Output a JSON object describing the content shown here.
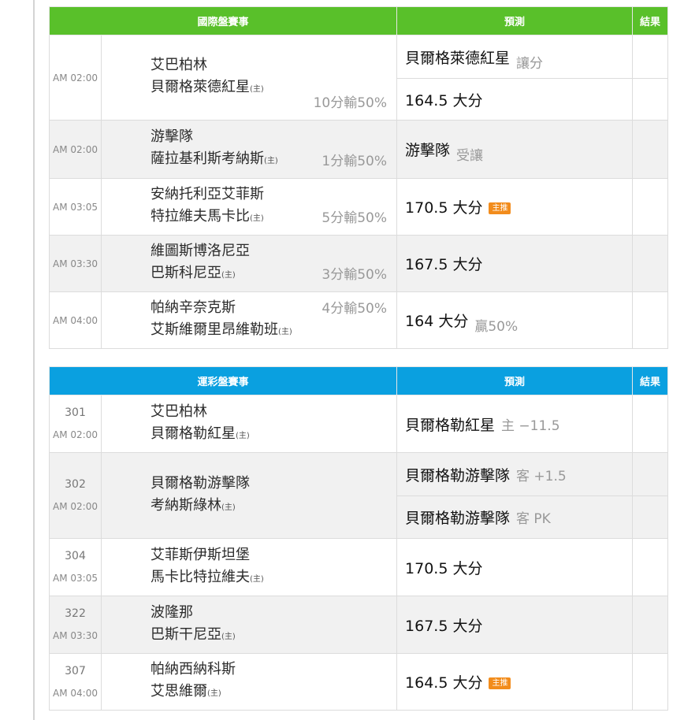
{
  "intl": {
    "header": {
      "matches": "國際盤賽事",
      "prediction": "預測",
      "result": "結果"
    },
    "rows": [
      {
        "time": "AM 02:00",
        "team1": "艾巴柏林",
        "team2": "貝爾格萊德紅星",
        "home_mark": "(主)",
        "handicap": "10分輸50%",
        "pred1": "貝爾格萊德紅星",
        "pred1_note": "讓分",
        "pred2": "164.5 大分"
      },
      {
        "time": "AM 02:00",
        "team1": "游擊隊",
        "team2": "薩拉基利斯考納斯",
        "home_mark": "(主)",
        "handicap": "1分輸50%",
        "pred": "游擊隊",
        "pred_note": "受讓"
      },
      {
        "time": "AM 03:05",
        "team1": "安納托利亞艾菲斯",
        "team2": "特拉維夫馬卡比",
        "home_mark": "(主)",
        "handicap": "5分輸50%",
        "pred": "170.5 大分",
        "badge": "主推"
      },
      {
        "time": "AM 03:30",
        "team1": "維圖斯博洛尼亞",
        "team2": "巴斯科尼亞",
        "home_mark": "(主)",
        "handicap": "3分輸50%",
        "pred": "167.5 大分"
      },
      {
        "time": "AM 04:00",
        "team1": "帕納辛奈克斯",
        "team2": "艾斯維爾里昂維勒班",
        "home_mark": "(主)",
        "handicap": "4分輸50%",
        "pred": "164 大分",
        "pred_note": "贏50%"
      }
    ]
  },
  "lottery": {
    "header": {
      "matches": "運彩盤賽事",
      "prediction": "預測",
      "result": "結果"
    },
    "rows": [
      {
        "code": "301",
        "time": "AM 02:00",
        "team1": "艾巴柏林",
        "team2": "貝爾格勒紅星",
        "home_mark": "(主)",
        "pred": "貝爾格勒紅星",
        "pred_note": "主 −11.5"
      },
      {
        "code": "302",
        "time": "AM 02:00",
        "team1": "貝爾格勒游擊隊",
        "team2": "考納斯綠林",
        "home_mark": "(主)",
        "pred1": "貝爾格勒游擊隊",
        "pred1_note": "客 +1.5",
        "pred2": "貝爾格勒游擊隊",
        "pred2_note": "客 PK"
      },
      {
        "code": "304",
        "time": "AM 03:05",
        "team1": "艾菲斯伊斯坦堡",
        "team2": "馬卡比特拉維夫",
        "home_mark": "(主)",
        "pred": "170.5 大分"
      },
      {
        "code": "322",
        "time": "AM 03:30",
        "team1": "波隆那",
        "team2": "巴斯干尼亞",
        "home_mark": "(主)",
        "pred": "167.5 大分"
      },
      {
        "code": "307",
        "time": "AM 04:00",
        "team1": "帕納西納科斯",
        "team2": "艾思維爾",
        "home_mark": "(主)",
        "pred": "164.5 大分",
        "badge": "主推"
      }
    ]
  }
}
